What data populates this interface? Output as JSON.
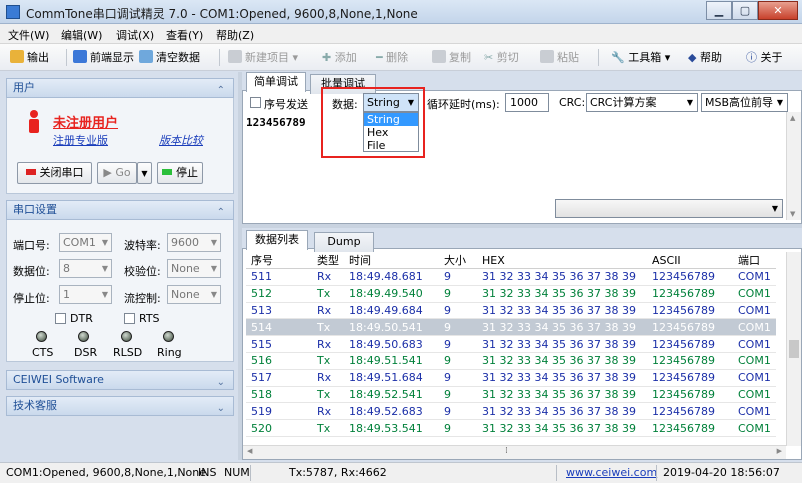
{
  "window": {
    "title": "CommTone串口调试精灵 7.0 - COM1:Opened, 9600,8,None,1,None",
    "minimize": "▁",
    "maximize": "▢",
    "close": "✕"
  },
  "menu": [
    "文件(W)",
    "编辑(W)",
    "调试(X)",
    "查看(Y)",
    "帮助(Z)"
  ],
  "toolbar": {
    "output": "输出",
    "front_display": "前端显示",
    "clear_data": "清空数据",
    "new_item": "新建项目",
    "add": "添加",
    "delete": "删除",
    "copy": "复制",
    "cut": "剪切",
    "paste": "粘贴",
    "toolbox": "工具箱",
    "help": "帮助",
    "about": "关于"
  },
  "user_panel": {
    "header": "用户",
    "name": "未注册用户",
    "register_link": "注册专业版",
    "compare_link": "版本比较",
    "close_port": "关闭串口",
    "go": "Go",
    "stop": "停止"
  },
  "serial_panel": {
    "header": "串口设置",
    "port_label": "端口号:",
    "port_value": "COM1",
    "baud_label": "波特率:",
    "baud_value": "9600",
    "databits_label": "数据位:",
    "databits_value": "8",
    "parity_label": "校验位:",
    "parity_value": "None",
    "stopbits_label": "停止位:",
    "stopbits_value": "1",
    "flow_label": "流控制:",
    "flow_value": "None",
    "dtr": "DTR",
    "rts": "RTS",
    "leds": [
      "CTS",
      "DSR",
      "RLSD",
      "Ring"
    ]
  },
  "sections": {
    "ceiwei": "CEIWEI Software",
    "support": "技术客服"
  },
  "send_area": {
    "tab_simple": "简单调试",
    "tab_batch": "批量调试",
    "seq_send": "序号发送",
    "data_label": "数据:",
    "data_type": "String",
    "data_options": [
      "String",
      "Hex",
      "File"
    ],
    "loop_label": "循环延时(ms):",
    "loop_value": "1000",
    "crc_label": "CRC:",
    "crc_value": "CRC计算方案",
    "msb_value": "MSB高位前导",
    "send_text": "123456789"
  },
  "data_list": {
    "tab_list": "数据列表",
    "tab_dump": "Dump",
    "columns": [
      "序号",
      "类型",
      "时间",
      "大小",
      "HEX",
      "ASCII",
      "端口"
    ],
    "rows": [
      [
        "511",
        "Rx",
        "18:49.48.681",
        "9",
        "31 32 33 34 35 36 37 38 39",
        "123456789",
        "COM1"
      ],
      [
        "512",
        "Tx",
        "18:49.49.540",
        "9",
        "31 32 33 34 35 36 37 38 39",
        "123456789",
        "COM1"
      ],
      [
        "513",
        "Rx",
        "18:49.49.684",
        "9",
        "31 32 33 34 35 36 37 38 39",
        "123456789",
        "COM1"
      ],
      [
        "514",
        "Tx",
        "18:49.50.541",
        "9",
        "31 32 33 34 35 36 37 38 39",
        "123456789",
        "COM1"
      ],
      [
        "515",
        "Rx",
        "18:49.50.683",
        "9",
        "31 32 33 34 35 36 37 38 39",
        "123456789",
        "COM1"
      ],
      [
        "516",
        "Tx",
        "18:49.51.541",
        "9",
        "31 32 33 34 35 36 37 38 39",
        "123456789",
        "COM1"
      ],
      [
        "517",
        "Rx",
        "18:49.51.684",
        "9",
        "31 32 33 34 35 36 37 38 39",
        "123456789",
        "COM1"
      ],
      [
        "518",
        "Tx",
        "18:49.52.541",
        "9",
        "31 32 33 34 35 36 37 38 39",
        "123456789",
        "COM1"
      ],
      [
        "519",
        "Rx",
        "18:49.52.683",
        "9",
        "31 32 33 34 35 36 37 38 39",
        "123456789",
        "COM1"
      ],
      [
        "520",
        "Tx",
        "18:49.53.541",
        "9",
        "31 32 33 34 35 36 37 38 39",
        "123456789",
        "COM1"
      ]
    ],
    "selected_row": 3
  },
  "status": {
    "port": "COM1:Opened, 9600,8,None,1,None",
    "ins": "INS",
    "num": "NUM",
    "counts": "Tx:5787, Rx:4662",
    "website": "www.ceiwei.com",
    "datetime": "2019-04-20 18:56:07"
  },
  "colors": {
    "tx": "#00803a",
    "rx": "#1b2fa8",
    "highlight": "#e8231f",
    "link": "#1a3dbb"
  }
}
